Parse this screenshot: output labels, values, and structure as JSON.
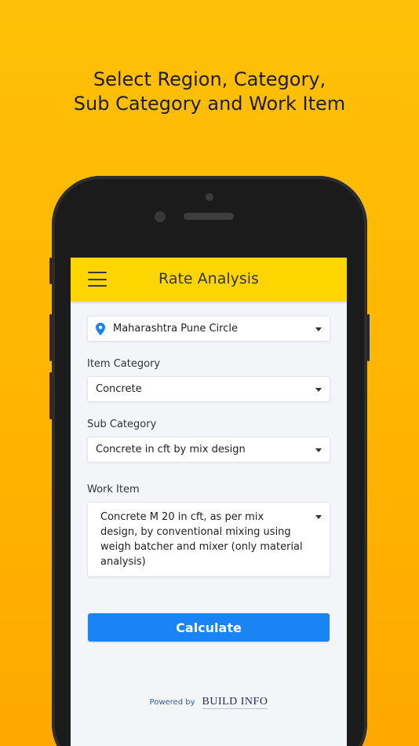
{
  "headline": {
    "line1": "Select Region, Category,",
    "line2": "Sub Category and Work Item"
  },
  "appbar": {
    "title": "Rate Analysis",
    "menu_icon": "hamburger-menu-icon"
  },
  "region": {
    "icon": "location-pin-icon",
    "value": "Maharashtra Pune Circle"
  },
  "item_category": {
    "label": "Item Category",
    "value": "Concrete"
  },
  "sub_category": {
    "label": "Sub Category",
    "value": "Concrete in cft by mix design"
  },
  "work_item": {
    "label": "Work Item",
    "value": "Concrete M 20 in cft, as per mix design, by conventional mixing using weigh batcher and mixer (only material analysis)"
  },
  "calculate": {
    "label": "Calculate"
  },
  "footer": {
    "powered_by": "Powered by",
    "brand": "BUILD INFO"
  },
  "colors": {
    "background": "#FFC107",
    "appbar": "#FFD500",
    "button": "#1A84F5",
    "pin": "#1A84F5"
  }
}
